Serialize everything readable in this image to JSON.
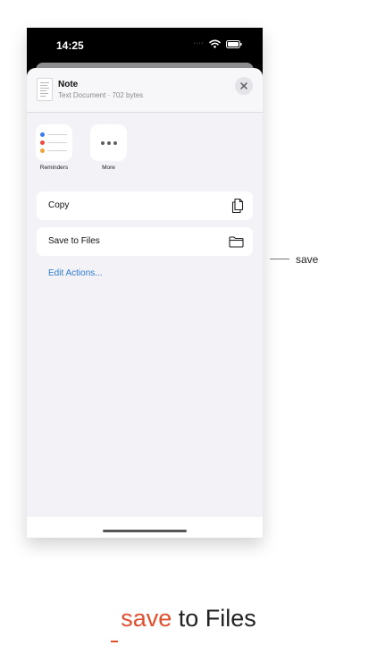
{
  "status_bar": {
    "time": "14:25",
    "signal_dots": "····"
  },
  "share_sheet": {
    "document": {
      "title": "Note",
      "subtitle": "Text Document · 702 bytes"
    },
    "apps": [
      {
        "label": "Reminders",
        "icon": "reminders-icon"
      },
      {
        "label": "More",
        "icon": "more-icon"
      }
    ],
    "actions": [
      {
        "label": "Copy",
        "icon": "copy-icon"
      },
      {
        "label": "Save to Files",
        "icon": "folder-icon"
      }
    ],
    "edit_actions_label": "Edit Actions..."
  },
  "callout": {
    "label": "save"
  },
  "caption": {
    "highlight": "save",
    "rest": " to Files"
  },
  "colors": {
    "accent": "#e0502e",
    "link": "#2f7bd1",
    "sheet_bg": "#f2f2f7"
  }
}
